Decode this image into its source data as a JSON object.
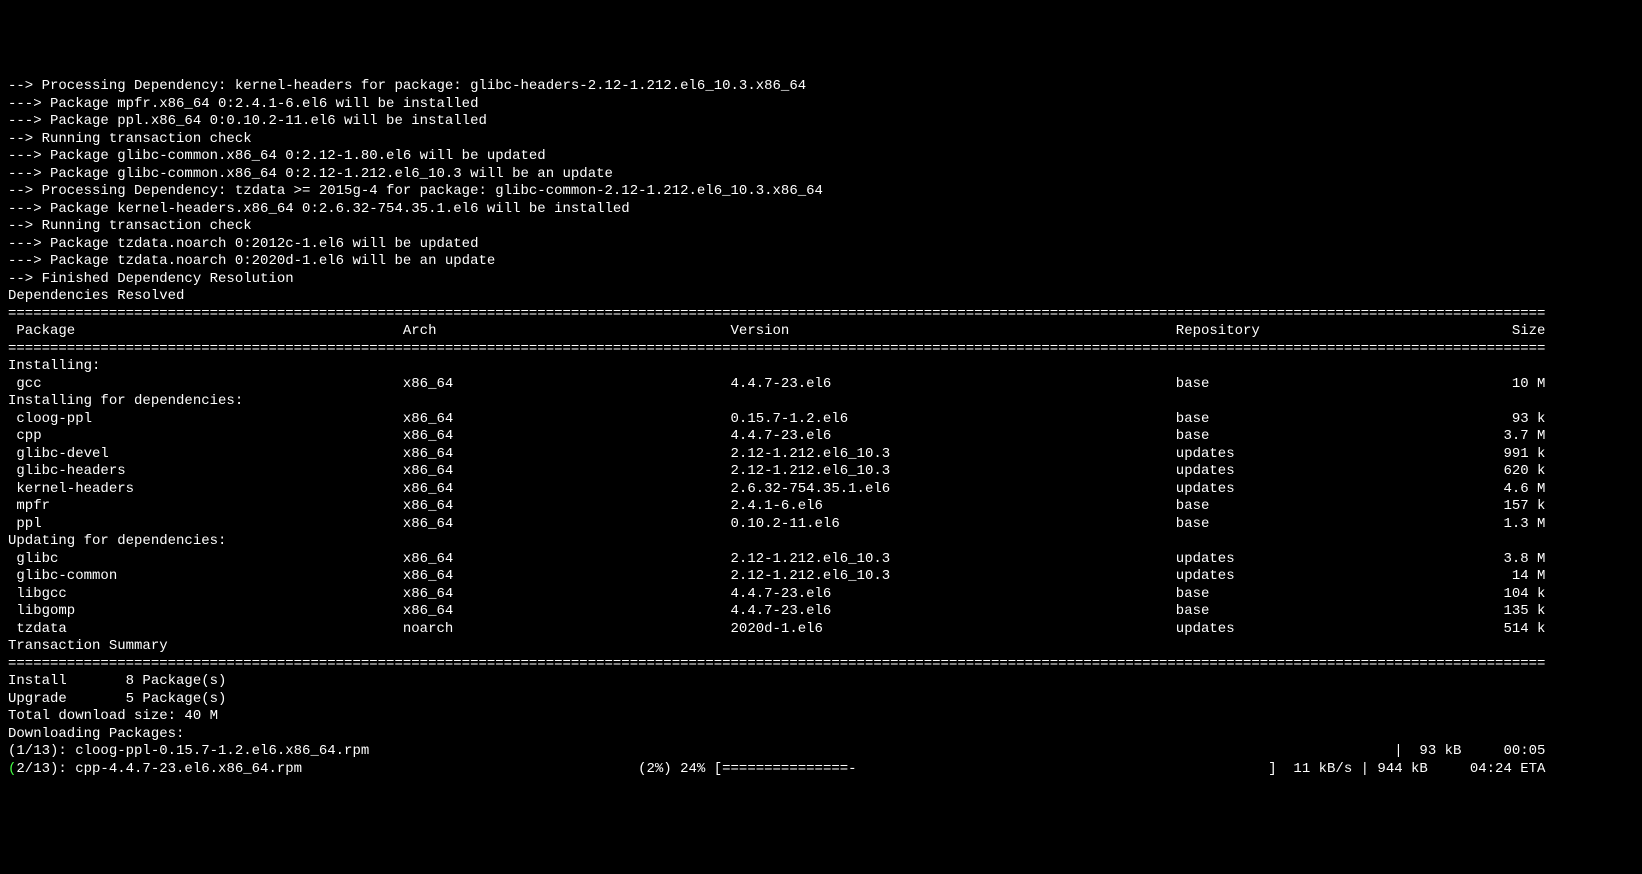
{
  "depLines": [
    "--> Processing Dependency: kernel-headers for package: glibc-headers-2.12-1.212.el6_10.3.x86_64",
    "---> Package mpfr.x86_64 0:2.4.1-6.el6 will be installed",
    "---> Package ppl.x86_64 0:0.10.2-11.el6 will be installed",
    "--> Running transaction check",
    "---> Package glibc-common.x86_64 0:2.12-1.80.el6 will be updated",
    "---> Package glibc-common.x86_64 0:2.12-1.212.el6_10.3 will be an update",
    "--> Processing Dependency: tzdata >= 2015g-4 for package: glibc-common-2.12-1.212.el6_10.3.x86_64",
    "---> Package kernel-headers.x86_64 0:2.6.32-754.35.1.el6 will be installed",
    "--> Running transaction check",
    "---> Package tzdata.noarch 0:2012c-1.el6 will be updated",
    "---> Package tzdata.noarch 0:2020d-1.el6 will be an update",
    "--> Finished Dependency Resolution",
    "",
    "Dependencies Resolved",
    ""
  ],
  "tableHeader": {
    "c0": "Package",
    "c1": "Arch",
    "c2": "Version",
    "c3": "Repository",
    "c4": "Size"
  },
  "sections": {
    "installing": "Installing:",
    "installingDeps": "Installing for dependencies:",
    "updatingDeps": "Updating for dependencies:"
  },
  "installing": [
    {
      "pkg": "gcc",
      "arch": "x86_64",
      "ver": "4.4.7-23.el6",
      "repo": "base",
      "size": "10 M"
    }
  ],
  "installingDeps": [
    {
      "pkg": "cloog-ppl",
      "arch": "x86_64",
      "ver": "0.15.7-1.2.el6",
      "repo": "base",
      "size": "93 k"
    },
    {
      "pkg": "cpp",
      "arch": "x86_64",
      "ver": "4.4.7-23.el6",
      "repo": "base",
      "size": "3.7 M"
    },
    {
      "pkg": "glibc-devel",
      "arch": "x86_64",
      "ver": "2.12-1.212.el6_10.3",
      "repo": "updates",
      "size": "991 k"
    },
    {
      "pkg": "glibc-headers",
      "arch": "x86_64",
      "ver": "2.12-1.212.el6_10.3",
      "repo": "updates",
      "size": "620 k"
    },
    {
      "pkg": "kernel-headers",
      "arch": "x86_64",
      "ver": "2.6.32-754.35.1.el6",
      "repo": "updates",
      "size": "4.6 M"
    },
    {
      "pkg": "mpfr",
      "arch": "x86_64",
      "ver": "2.4.1-6.el6",
      "repo": "base",
      "size": "157 k"
    },
    {
      "pkg": "ppl",
      "arch": "x86_64",
      "ver": "0.10.2-11.el6",
      "repo": "base",
      "size": "1.3 M"
    }
  ],
  "updatingDeps": [
    {
      "pkg": "glibc",
      "arch": "x86_64",
      "ver": "2.12-1.212.el6_10.3",
      "repo": "updates",
      "size": "3.8 M"
    },
    {
      "pkg": "glibc-common",
      "arch": "x86_64",
      "ver": "2.12-1.212.el6_10.3",
      "repo": "updates",
      "size": "14 M"
    },
    {
      "pkg": "libgcc",
      "arch": "x86_64",
      "ver": "4.4.7-23.el6",
      "repo": "base",
      "size": "104 k"
    },
    {
      "pkg": "libgomp",
      "arch": "x86_64",
      "ver": "4.4.7-23.el6",
      "repo": "base",
      "size": "135 k"
    },
    {
      "pkg": "tzdata",
      "arch": "noarch",
      "ver": "2020d-1.el6",
      "repo": "updates",
      "size": "514 k"
    }
  ],
  "txSummaryLabel": "Transaction Summary",
  "txSummary": [
    "Install       8 Package(s)",
    "Upgrade       5 Package(s)"
  ],
  "totalDownload": "Total download size: 40 M",
  "downloadingLabel": "Downloading Packages:",
  "download1": {
    "left": "(1/13): cloog-ppl-0.15.7-1.2.el6.x86_64.rpm",
    "right": "|  93 kB     00:05"
  },
  "download2": {
    "prefix": "(",
    "left": "2/13): cpp-4.4.7-23.el6.x86_64.rpm",
    "pct": "(2%) 24%",
    "barFill": "===============-",
    "right": "]  11 kB/s | 944 kB     04:24 ETA"
  },
  "cols": {
    "c0": 1,
    "c1": 47,
    "c2": 86,
    "c3": 139,
    "totalWidth": 183
  }
}
